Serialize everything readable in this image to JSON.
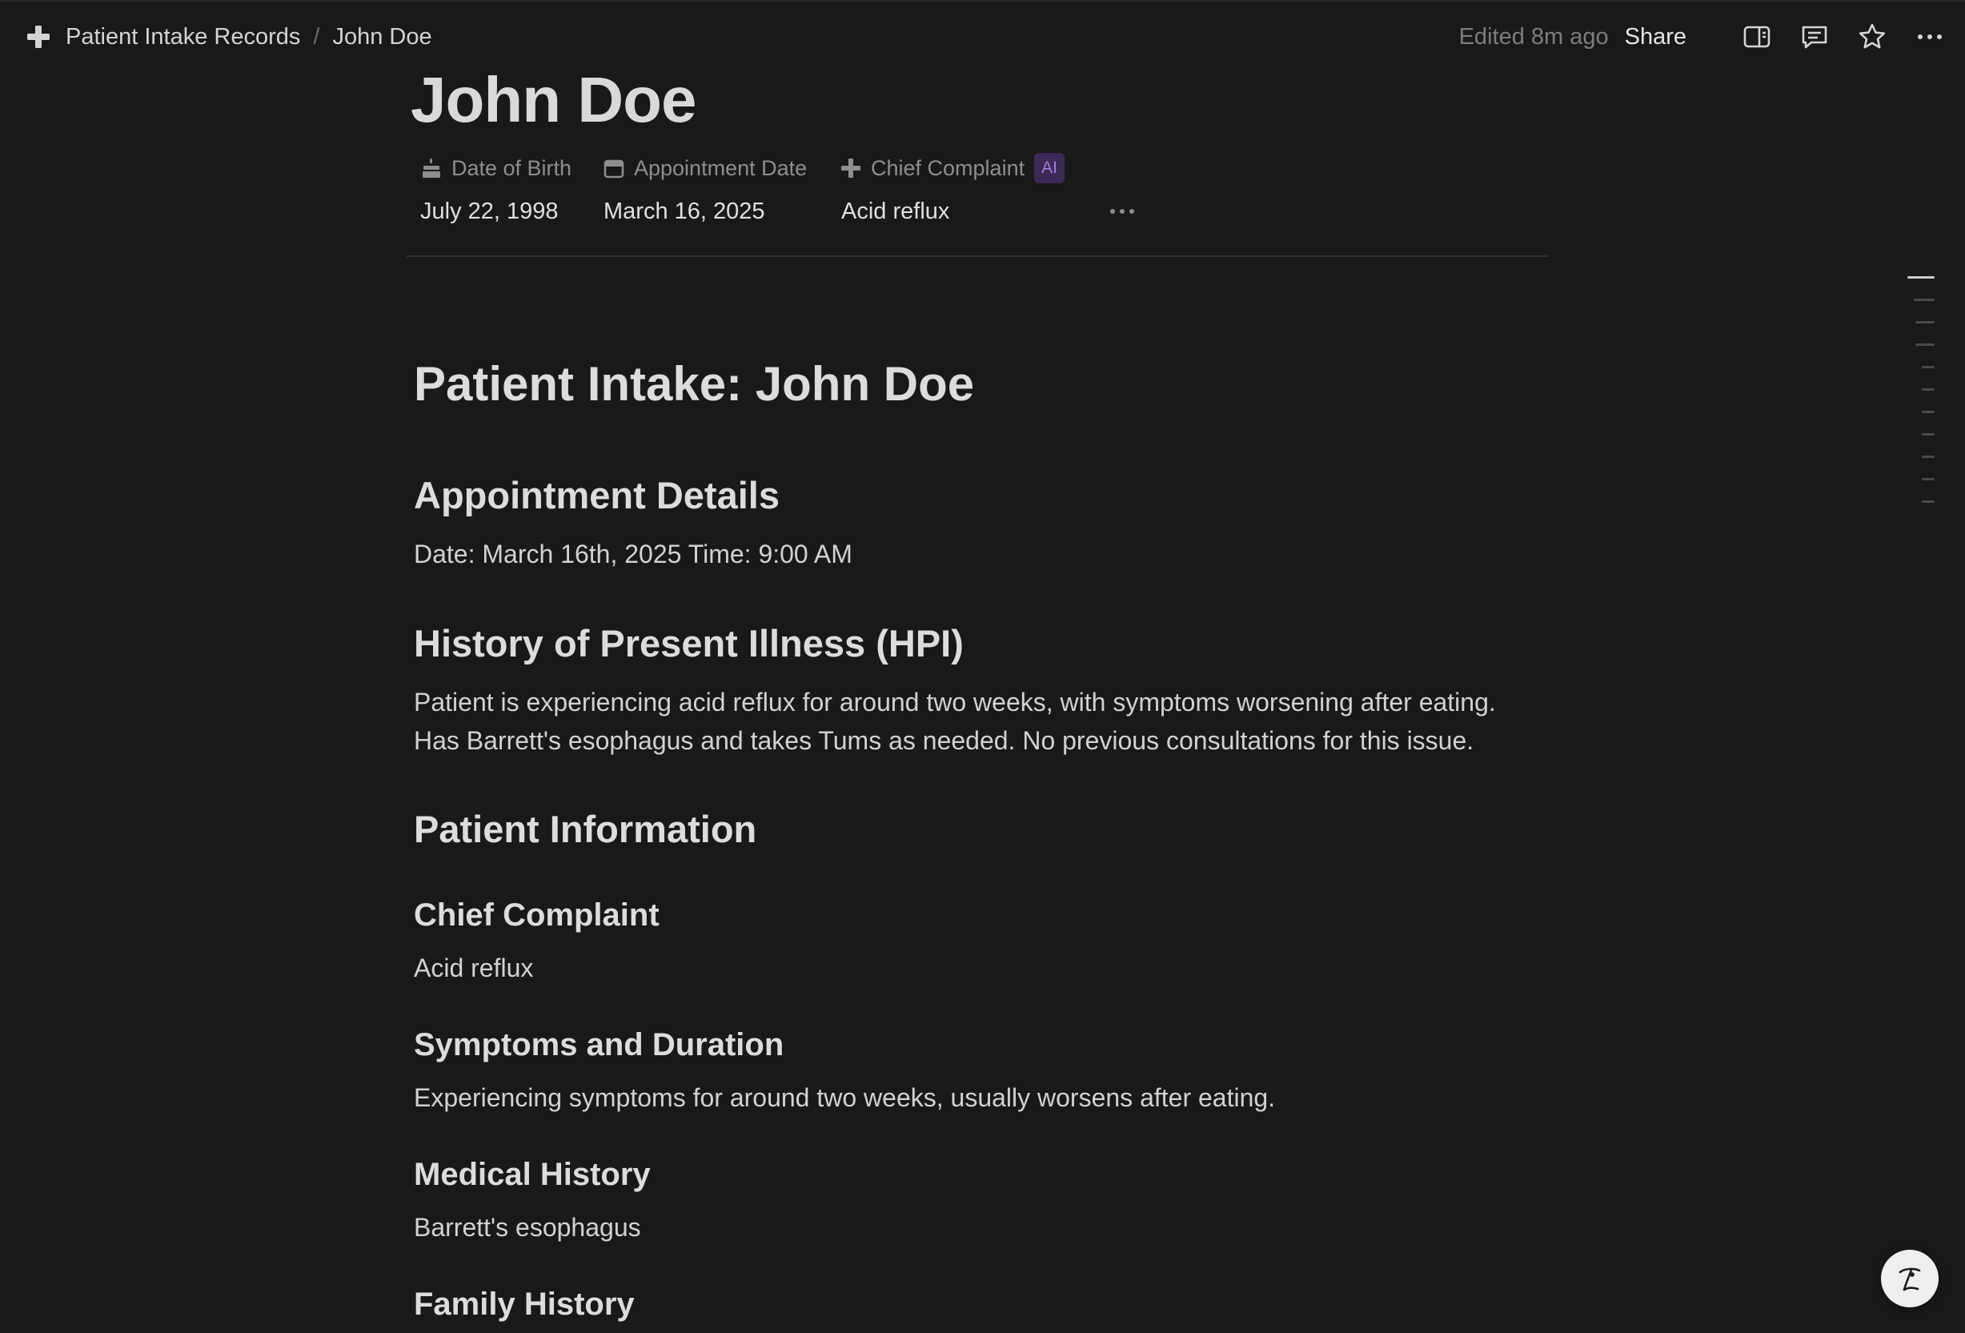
{
  "breadcrumb": {
    "parent": "Patient Intake Records",
    "separator": "/",
    "current": "John Doe",
    "parent_icon": "plus-icon"
  },
  "topbar": {
    "edited": "Edited 8m ago",
    "share_label": "Share",
    "icons": [
      "sidebar-panel-icon",
      "comment-icon",
      "star-icon",
      "more-icon"
    ]
  },
  "page": {
    "title": "John Doe"
  },
  "properties": {
    "dob": {
      "label": "Date of Birth",
      "value": "July 22, 1998",
      "icon": "cake-icon"
    },
    "appointment": {
      "label": "Appointment Date",
      "value": "March 16, 2025",
      "icon": "calendar-icon"
    },
    "complaint": {
      "label": "Chief Complaint",
      "value": "Acid reflux",
      "icon": "plus-icon",
      "badge": "AI"
    }
  },
  "content": {
    "h1": "Patient Intake: John Doe",
    "appointment_heading": "Appointment Details",
    "appointment_text": "Date: March 16th, 2025 Time: 9:00 AM",
    "hpi_heading": "History of Present Illness (HPI)",
    "hpi_line1": "Patient is experiencing acid reflux for around two weeks, with symptoms worsening after eating.",
    "hpi_line2": "Has Barrett's esophagus and takes Tums as needed. No previous consultations for this issue.",
    "patient_info_heading": "Patient Information",
    "chief_complaint_heading": "Chief Complaint",
    "chief_complaint_text": "Acid reflux",
    "symptoms_heading": "Symptoms and Duration",
    "symptoms_text": "Experiencing symptoms for around two weeks, usually worsens after eating.",
    "medical_history_heading": "Medical History",
    "medical_history_text": "Barrett's esophagus",
    "family_history_heading": "Family History"
  },
  "colors": {
    "background": "#191919",
    "text": "#d4d4d4",
    "muted": "#8e8e8e",
    "ai_badge_bg": "#3b2a55",
    "ai_badge_fg": "#a27ee0"
  }
}
